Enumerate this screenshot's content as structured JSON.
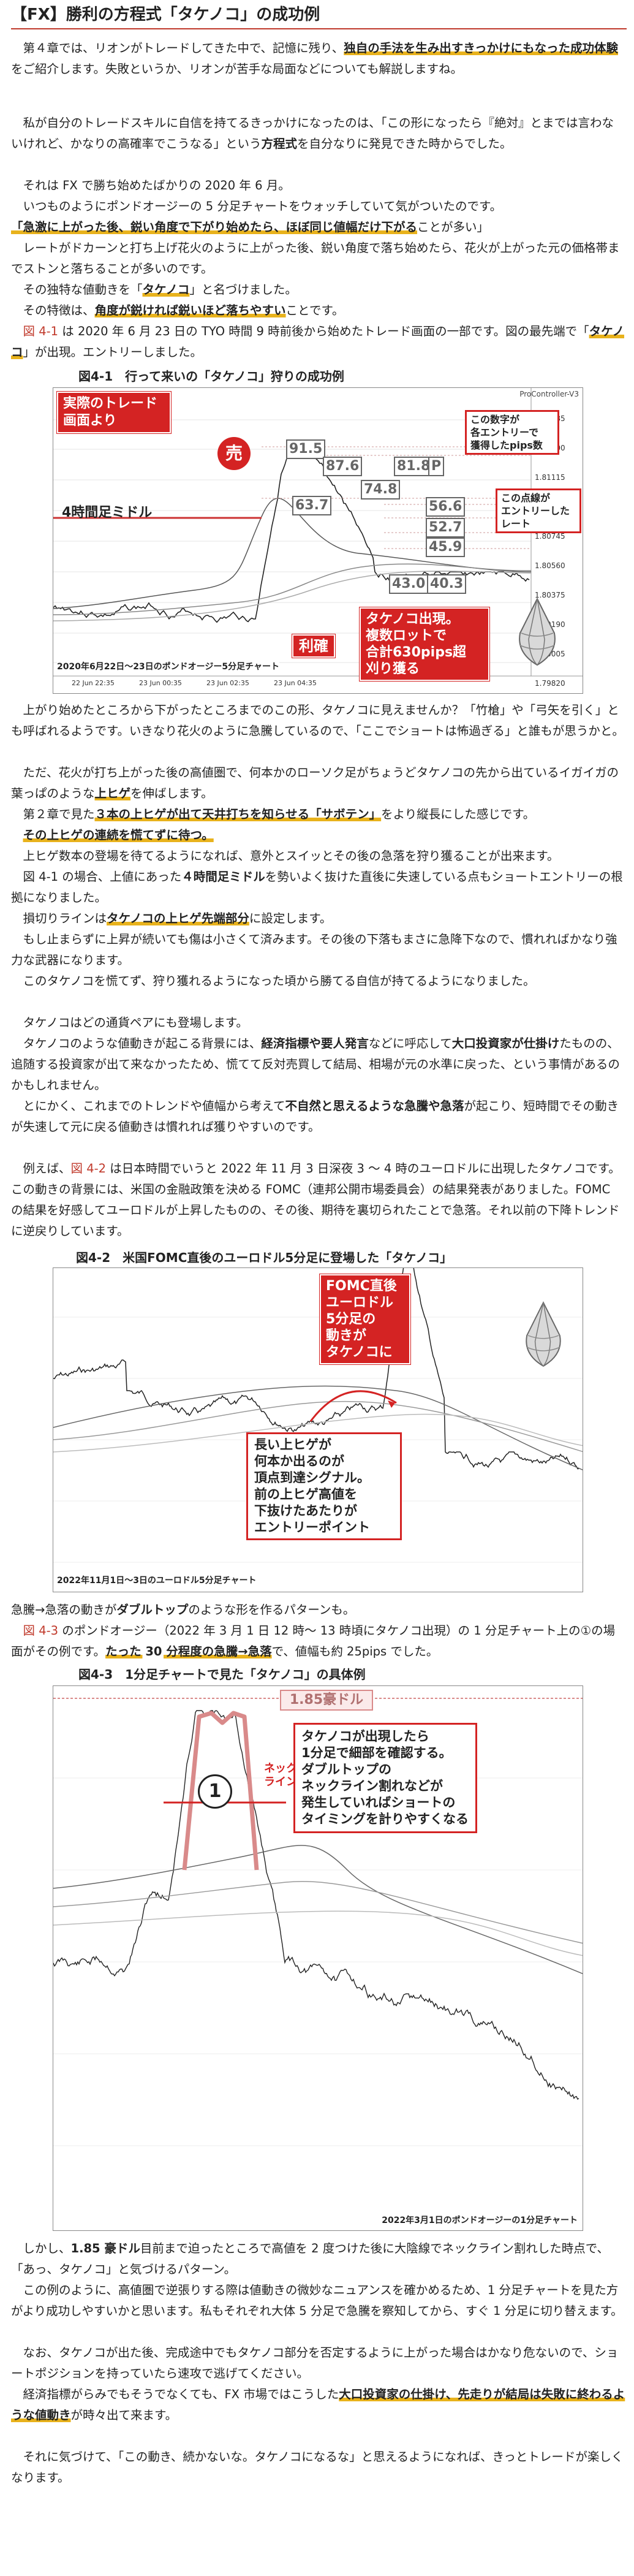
{
  "title": "【FX】勝利の方程式「タケノコ」の成功例",
  "p1a": "第４章では、リオンがトレードしてきた中で、記憶に残り、",
  "p1b": "独自の手法を生み出すきっかけにもなった成功体験",
  "p1c": "をご紹介します。失敗というか、リオンが苦手な局面などについても解説しますね。",
  "p2a": "私が自分のトレードスキルに自信を持てるきっかけになったのは、「この形になったら『絶対』とまでは言わないけれど、かなりの高確率でこうなる」という",
  "p2b": "方程式",
  "p2c": "を自分なりに発見できた時からでした。",
  "p3": "それは FX で勝ち始めたばかりの 2020 年 6 月。",
  "p4": "いつものようにポンドオージーの 5 分足チャートをウォッチしていて気がついたのです。",
  "p5": "「急激に上がった後、鋭い角度で下がり始めたら、ほぼ同じ値幅だけ下がる",
  "p5b": "ことが多い」",
  "p6": "レートがドカーンと打ち上げ花火のように上がった後、鋭い角度で落ち始めたら、花火が上がった元の価格帯までストンと落ちることが多いのです。",
  "p7a": "その独特な値動きを「",
  "p7b": "タケノコ",
  "p7c": "」と名づけました。",
  "p8a": "その特徴は、",
  "p8b": "角度が鋭ければ鋭いほど落ちやすい",
  "p8c": "ことです。",
  "p9a": "図 4-1",
  "p9b": " は 2020 年 6 月 23 日の TYO 時間 9 時前後から始めたトレード画面の一部です。図の最先端で「",
  "p9c": "タケノコ",
  "p9d": "」が出現。エントリーしました。",
  "fig1": {
    "caption": "図4-1　行って来いの「タケノコ」狩りの成功例",
    "platform": "ProController-V3",
    "screen_label": "実際のトレード\n画面より",
    "ma_label": "4時間足ミドル",
    "sell": "売",
    "take_profit": "利確",
    "numbers_note": "この数字が\n各エントリーで\n獲得したpips数",
    "dotted_note": "この点線が\nエントリーした\nレート",
    "summary": "タケノコ出現。\n複数ロットで\n合計630pips超\n刈り獲る",
    "chart_footer": "2020年6月22日〜23日のポンドオージー5分足チャート",
    "pips": [
      "91.5",
      "87.6",
      "81.8",
      "P",
      "63.7",
      "74.8",
      "56.6",
      "52.7",
      "45.9",
      "43.0",
      "40.3"
    ],
    "prices": [
      "1.81485",
      "1.81300",
      "1.81115",
      "1.80930",
      "1.80745",
      "1.80560",
      "1.80375",
      "1.80190",
      "1.80005",
      "1.79820"
    ],
    "dates": [
      "22 Jun 22:35",
      "23 Jun 00:35",
      "23 Jun 02:35",
      "23 Jun 04:35"
    ]
  },
  "p10": "上がり始めたところから下がったところまでのこの形、タケノコに見えませんか？「竹槍」や「弓矢を引く」とも呼ばれるようです。いきなり花火のように急騰しているので、「ここでショートは怖過ぎる」と誰もが思うかと。",
  "p11": "ただ、花火が打ち上がった後の高値圏で、何本かのローソク足がちょうどタケノコの先から出ているイガイガの葉っぱのような",
  "p11b": "上ヒゲ",
  "p11c": "を伸ばします。",
  "p12a": "第２章で見た",
  "p12b": "３本の上ヒゲが出て天井打ちを知らせる「サボテン」",
  "p12c": "をより縦長にした感じです。",
  "p13": "その上ヒゲの連続を慌てずに待つ。",
  "p14": "上ヒゲ数本の登場を待てるようになれば、意外とスイッとその後の急落を狩り獲ることが出来ます。",
  "p15a": "図 4-1 の場合、上値にあった",
  "p15b": "４時間足ミドル",
  "p15c": "を勢いよく抜けた直後に失速している点もショートエントリーの根拠になりました。",
  "p16a": "損切りラインは",
  "p16b": "タケノコの上ヒゲ先端部分",
  "p16c": "に設定します。",
  "p17": "もし止まらずに上昇が続いても傷は小さくて済みます。その後の下落もまさに急降下なので、慣れればかなり強力な武器になります。",
  "p18": "このタケノコを慌てず、狩り獲れるようになった頃から勝てる自信が持てるようになりました。",
  "p19": "タケノコはどの通貨ペアにも登場します。",
  "p20a": "タケノコのような値動きが起こる背景には、",
  "p20b": "経済指標や要人発言",
  "p20c": "などに呼応して",
  "p20d": "大口投資家が仕掛け",
  "p20e": "たものの、追随する投資家が出て来なかったため、慌てて反対売買して結局、相場が元の水準に戻った、という事情があるのかもしれません。",
  "p21a": "とにかく、これまでのトレンドや値幅から考えて",
  "p21b": "不自然と思えるような急騰や急落",
  "p21c": "が起こり、短時間でその動きが失速して元に戻る値動きは慣れれば獲りやすいのです。",
  "p22a": "例えば、",
  "p22b": "図 4-2",
  "p22c": " は日本時間でいうと 2022 年 11 月 3 日深夜 3 〜 4 時のユーロドルに出現したタケノコです。この動きの背景には、米国の金融政策を決める FOMC（連邦公開市場委員会）の結果発表がありました。FOMC の結果を好感してユーロドルが上昇したものの、その後、期待を裏切られたことで急落。それ以前の下降トレンドに逆戻りしています。",
  "fig2": {
    "caption": "図4-2　米国FOMC直後のユーロドル5分足に登場した「タケノコ」",
    "note": "FOMC直後\nユーロドル\n5分足の\n動きが\nタケノコに",
    "signal": "長い上ヒゲが\n何本か出るのが\n頂点到達シグナル。\n前の上ヒゲ高値を\n下抜けたあたりが\nエントリーポイント",
    "chart_footer": "2022年11月1日〜3日のユーロドル5分足チャート"
  },
  "p23a": "急騰→急落の動きが",
  "p23b": "ダブルトップ",
  "p23c": "のような形を作るパターンも。",
  "p24a": "図 4-3",
  "p24b": " のポンドオージー（2022 年 3 月 1 日 12 時〜 13 時頃にタケノコ出現）の 1 分足チャート上の①の場面がその例です。",
  "p24c": "たった 30 分程度の急騰→急落",
  "p24d": "で、値幅も約 25pips でした。",
  "fig3": {
    "caption": "図4-3　1分足チャートで見た「タケノコ」の具体例",
    "middle_label": "1.85豪ドル",
    "neckline": "ネック\nライン",
    "marker": "1",
    "note": "タケノコが出現したら\n1分足で細部を確認する。\nダブルトップの\nネックライン割れなどが\n発生していればショートの\nタイミングを計りやすくなる",
    "chart_footer": "2022年3月1日のポンドオージーの1分足チャート"
  },
  "p25a": "しかし、",
  "p25b": "1.85 豪ドル",
  "p25c": "目前まで迫ったところで高値を 2 度つけた後に大陰線でネックライン割れした時点で、「あっ、タケノコ」と気づけるパターン。",
  "p26": "この例のように、高値圏で逆張りする際は値動きの微妙なニュアンスを確かめるため、1 分足チャートを見た方がより成功しやすいかと思います。私もそれぞれ大体 5 分足で急騰を察知してから、すぐ 1 分足に切り替えます。",
  "p27": "なお、タケノコが出た後、完成途中でもタケノコ部分を否定するように上がった場合はかなり危ないので、ショートポジションを持っていたら速攻で逃げてください。",
  "p28a": "経済指標がらみでもそうでなくても、FX 市場ではこうした",
  "p28b": "大口投資家の仕掛け、先走りが結局は失敗に終わるような値動き",
  "p28c": "が時々出て来ます。",
  "p29": "それに気づけて、「この動き、続かないな。タケノコになるな」と思えるようになれば、きっとトレードが楽しくなります。"
}
